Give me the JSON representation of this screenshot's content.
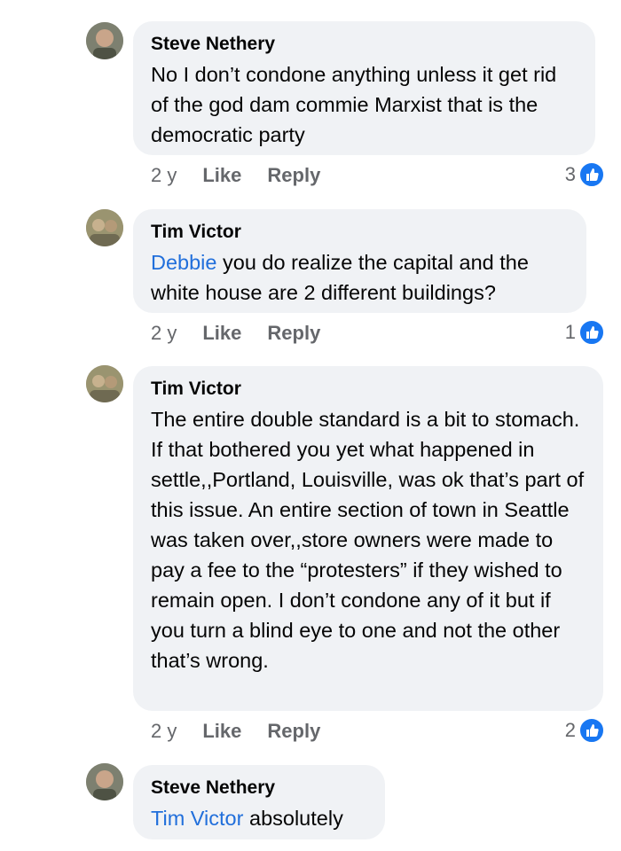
{
  "comments": [
    {
      "author": "Steve Nethery",
      "mention": "",
      "text": "No I don’t condone anything unless it get rid of the god dam commie Marxist that is the democratic party",
      "time": "2 y",
      "like_label": "Like",
      "reply_label": "Reply",
      "reaction_count": "3",
      "reaction_icon": "like-icon",
      "reaction_color": "#1877f2"
    },
    {
      "author": "Tim Victor",
      "mention": "Debbie",
      "text": " you do realize the capital and the white house are 2 different buildings?",
      "time": "2 y",
      "like_label": "Like",
      "reply_label": "Reply",
      "reaction_count": "1",
      "reaction_icon": "like-icon",
      "reaction_color": "#1877f2"
    },
    {
      "author": "Tim Victor",
      "mention": "",
      "text": "The entire double standard is a bit to stomach. If that bothered you yet what happened in settle,,Portland, Louisville, was ok that’s part of this issue.  An entire section of town in Seattle was taken over,,store owners were made to pay a fee to the “protesters” if they wished to remain open.  I don’t condone any of it but if you turn a blind eye to one and not the other that’s wrong.",
      "time": "2 y",
      "like_label": "Like",
      "reply_label": "Reply",
      "reaction_count": "2",
      "reaction_icon": "like-icon",
      "reaction_color": "#1877f2"
    },
    {
      "author": "Steve Nethery",
      "mention": "Tim Victor",
      "text": " absolutely"
    }
  ],
  "colors": {
    "mention": "#216fdb",
    "bubble_bg": "#f0f2f5",
    "meta_text": "#65676b"
  }
}
